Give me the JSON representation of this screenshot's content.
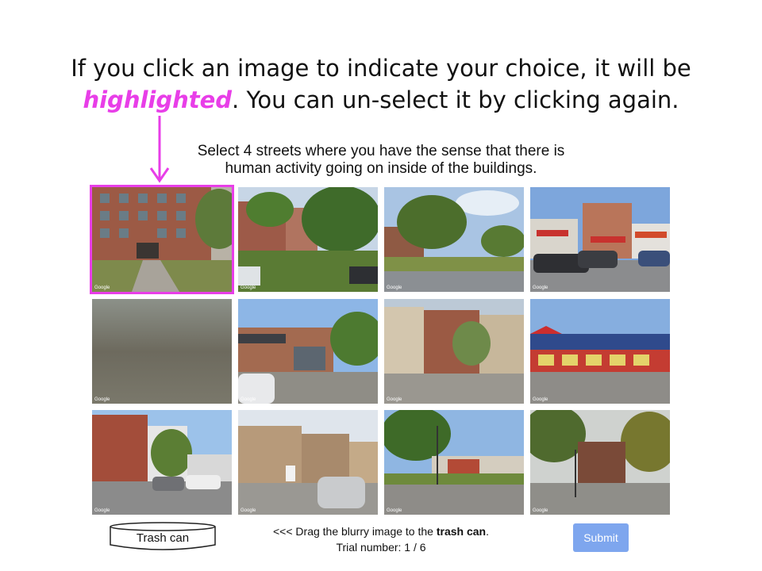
{
  "headline": {
    "line1": "If you click an image to indicate your choice, it will be",
    "line2_highlight": "highlighted",
    "line2_rest": ". You can un-select  it by clicking again."
  },
  "prompt": {
    "line1": "Select 4 streets where you have the sense that there is",
    "line2": "human activity going on inside of the buildings."
  },
  "tiles": [
    {
      "label": "Google",
      "selected": true
    },
    {
      "label": "Google",
      "selected": false
    },
    {
      "label": "Google",
      "selected": false
    },
    {
      "label": "Google",
      "selected": false
    },
    {
      "label": "Google",
      "selected": false
    },
    {
      "label": "Google",
      "selected": false
    },
    {
      "label": "Google",
      "selected": false
    },
    {
      "label": "Google",
      "selected": false
    },
    {
      "label": "Google",
      "selected": false
    },
    {
      "label": "Google",
      "selected": false
    },
    {
      "label": "Google",
      "selected": false
    },
    {
      "label": "Google",
      "selected": false
    }
  ],
  "trash": {
    "label": "Trash can"
  },
  "instructions": {
    "drag_prefix": "<<< Drag the blurry image to the ",
    "drag_bold": "trash can",
    "drag_suffix": ".",
    "trial": "Trial number: 1 / 6"
  },
  "submit": {
    "label": "Submit"
  },
  "colors": {
    "highlight": "#e83ee8",
    "submit": "#7ea6ee"
  }
}
